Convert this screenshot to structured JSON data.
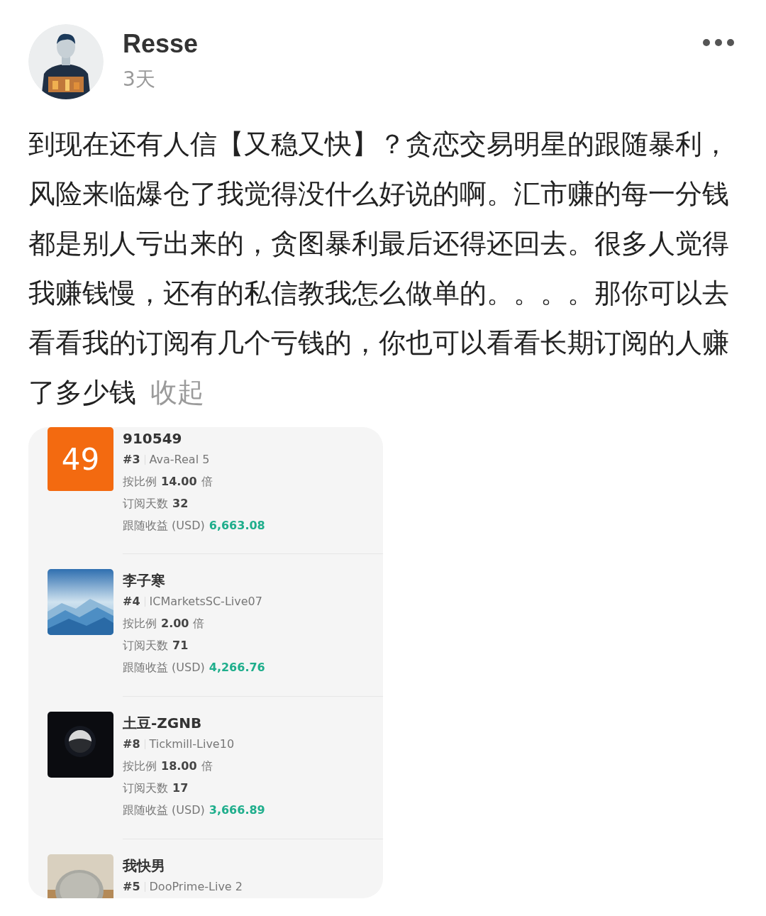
{
  "post": {
    "author": "Resse",
    "time": "3天",
    "text": "到现在还有人信【又稳又快】？贪恋交易明星的跟随暴利，风险来临爆仓了我觉得没什么好说的啊。汇市赚的每一分钱都是别人亏出来的，贪图暴利最后还得还回去。很多人觉得我赚钱慢，还有的私信教我怎么做单的。。。。那你可以去看看我的订阅有几个亏钱的，你也可以看看长期订阅的人赚了多少钱",
    "collapse_link": "收起"
  },
  "subscriptions": [
    {
      "avatar": {
        "kind": "number",
        "text": "49"
      },
      "name": "910549",
      "rank": "#3",
      "server": "Ava-Real 5",
      "ratio_label": "按比例",
      "ratio": "14.00",
      "ratio_unit": "倍",
      "days_label": "订阅天数",
      "days": "32",
      "profit_label": "跟随收益 (USD)",
      "profit": "6,663.08"
    },
    {
      "avatar": {
        "kind": "mountains"
      },
      "name": "李子寒",
      "rank": "#4",
      "server": "ICMarketsSC-Live07",
      "ratio_label": "按比例",
      "ratio": "2.00",
      "ratio_unit": "倍",
      "days_label": "订阅天数",
      "days": "71",
      "profit_label": "跟随收益 (USD)",
      "profit": "4,266.76"
    },
    {
      "avatar": {
        "kind": "moon"
      },
      "name": "土豆-ZGNB",
      "rank": "#8",
      "server": "Tickmill-Live10",
      "ratio_label": "按比例",
      "ratio": "18.00",
      "ratio_unit": "倍",
      "days_label": "订阅天数",
      "days": "17",
      "profit_label": "跟随收益 (USD)",
      "profit": "3,666.89"
    },
    {
      "avatar": {
        "kind": "stone"
      },
      "name": "我快男",
      "rank": "#5",
      "server": "DooPrime-Live 2"
    }
  ]
}
